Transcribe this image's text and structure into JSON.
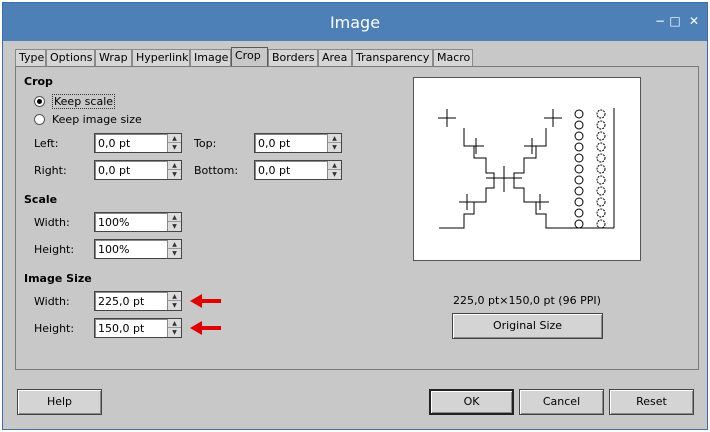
{
  "window": {
    "title": "Image"
  },
  "titlebar_icons": {
    "minimize": "minimize-icon",
    "maximize": "maximize-icon",
    "close": "close-icon"
  },
  "tabs": [
    {
      "label": "Type"
    },
    {
      "label": "Options"
    },
    {
      "label": "Wrap"
    },
    {
      "label": "Hyperlink"
    },
    {
      "label": "Image"
    },
    {
      "label": "Crop"
    },
    {
      "label": "Borders"
    },
    {
      "label": "Area"
    },
    {
      "label": "Transparency"
    },
    {
      "label": "Macro"
    }
  ],
  "active_tab": "Crop",
  "crop": {
    "heading": "Crop",
    "keep_scale": "Keep scale",
    "keep_image_size": "Keep image size",
    "selected": "Keep scale",
    "left_label": "Left:",
    "left_value": "0,0 pt",
    "top_label": "Top:",
    "top_value": "0,0 pt",
    "right_label": "Right:",
    "right_value": "0,0 pt",
    "bottom_label": "Bottom:",
    "bottom_value": "0,0 pt"
  },
  "scale": {
    "heading": "Scale",
    "width_label": "Width:",
    "width_value": "100%",
    "height_label": "Height:",
    "height_value": "100%"
  },
  "image_size": {
    "heading": "Image Size",
    "width_label": "Width:",
    "width_value": "225,0 pt",
    "height_label": "Height:",
    "height_value": "150,0 pt"
  },
  "preview": {
    "size_text": "225,0 pt×150,0 pt (96 PPI)",
    "original_size_button": "Original Size"
  },
  "annotation_color": "#e00000",
  "buttons": {
    "help": "Help",
    "ok": "OK",
    "cancel": "Cancel",
    "reset": "Reset"
  }
}
